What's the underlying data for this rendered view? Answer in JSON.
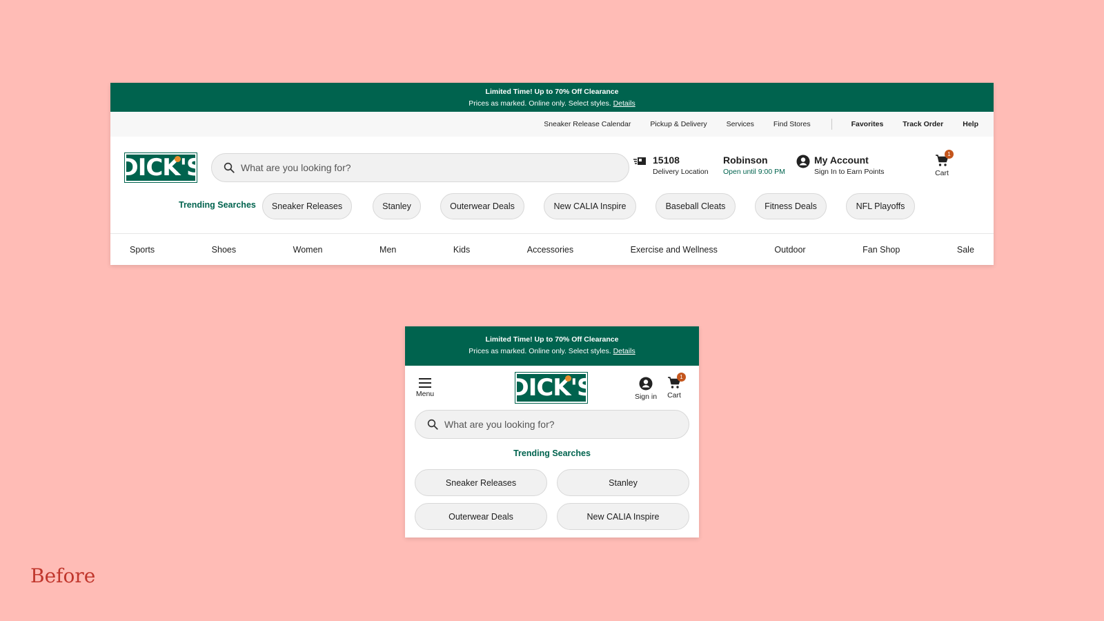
{
  "promo": {
    "headline": "Limited Time! Up to 70% Off Clearance",
    "subline": "Prices as marked. Online only. Select styles.",
    "details_link": "Details"
  },
  "utility_links": [
    "Sneaker Release Calendar",
    "Pickup & Delivery",
    "Services",
    "Find Stores"
  ],
  "utility_bold_links": [
    "Favorites",
    "Track Order",
    "Help"
  ],
  "logo_text": "DICK'S",
  "search": {
    "placeholder": "What are you looking for?"
  },
  "delivery": {
    "zip": "15108",
    "label": "Delivery Location"
  },
  "store": {
    "name": "Robinson",
    "hours": "Open until 9:00 PM"
  },
  "account": {
    "title": "My Account",
    "subtitle": "Sign In to Earn Points"
  },
  "cart": {
    "label": "Cart",
    "count": "1"
  },
  "trending": {
    "label": "Trending Searches",
    "chips": [
      "Sneaker Releases",
      "Stanley",
      "Outerwear Deals",
      "New CALIA Inspire",
      "Baseball Cleats",
      "Fitness Deals",
      "NFL Playoffs"
    ]
  },
  "nav": [
    "Sports",
    "Shoes",
    "Women",
    "Men",
    "Kids",
    "Accessories",
    "Exercise and Wellness",
    "Outdoor",
    "Fan Shop",
    "Sale"
  ],
  "mobile": {
    "menu_label": "Menu",
    "signin_label": "Sign in",
    "chips": [
      "Sneaker Releases",
      "Stanley",
      "Outerwear Deals",
      "New CALIA Inspire"
    ]
  },
  "caption": "Before",
  "colors": {
    "brand_green": "#00634e",
    "background": "#ffbcb6",
    "badge": "#c4561d",
    "accent_ball": "#e88d2a"
  }
}
